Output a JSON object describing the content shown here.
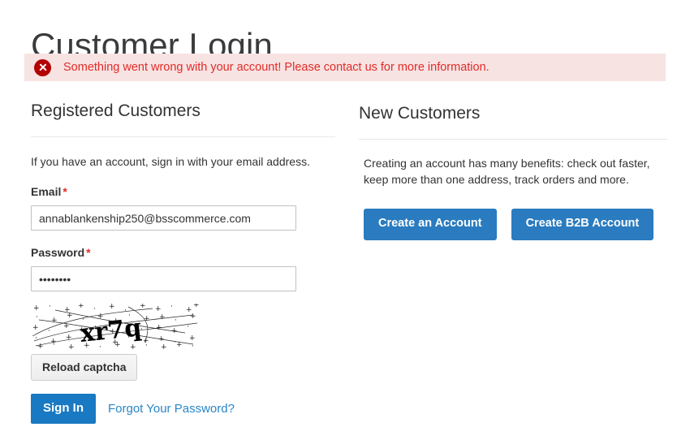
{
  "page": {
    "title": "Customer Login"
  },
  "message": {
    "icon": "error-circle-x-icon",
    "text": "Something went wrong with your account! Please contact us for more information.",
    "type": "error",
    "background_color": "#f8e3e3",
    "text_color": "#e02b27",
    "icon_color": "#b30000"
  },
  "registered": {
    "heading": "Registered Customers",
    "intro": "If you have an account, sign in with your email address.",
    "email": {
      "label": "Email",
      "required_mark": "*",
      "value": "annablankenship250@bsscommerce.com",
      "placeholder": ""
    },
    "password": {
      "label": "Password",
      "required_mark": "*",
      "value": "••••••••",
      "placeholder": ""
    },
    "captcha": {
      "image_text": "xr7q",
      "reload_label": "Reload captcha"
    },
    "sign_in_label": "Sign In",
    "forgot_password_label": "Forgot Your Password?"
  },
  "new_customers": {
    "heading": "New Customers",
    "intro": "Creating an account has many benefits: check out faster, keep more than one address, track orders and more.",
    "create_account_label": "Create an Account",
    "create_b2b_account_label": "Create B2B Account"
  },
  "colors": {
    "primary_blue": "#1979c3",
    "button_blue": "#2a7bbf",
    "link_blue": "#2a86c8",
    "text": "#333333",
    "rule": "#e8e8e8"
  }
}
